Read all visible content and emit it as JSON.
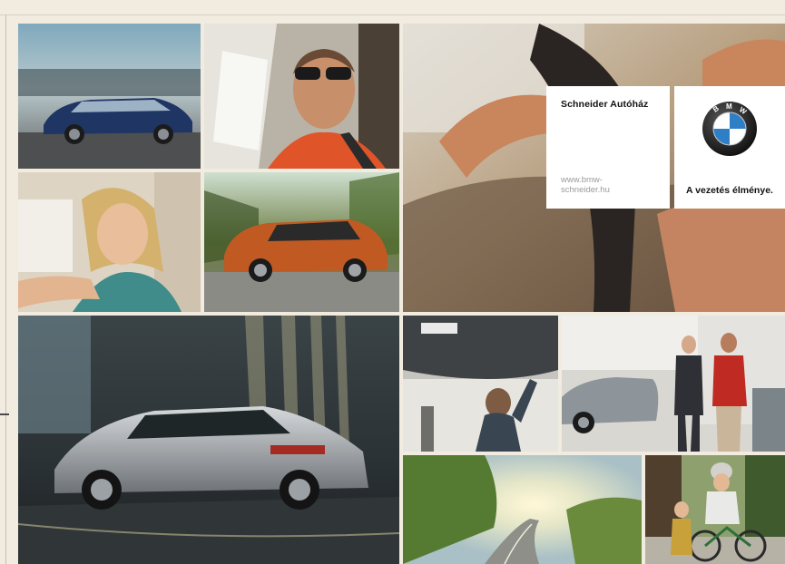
{
  "dealer": {
    "name": "Schneider Autóház",
    "url_line1": "www.bmw-",
    "url_line2": "schneider.hu"
  },
  "brand": {
    "logo_letters": [
      "B",
      "M",
      "W"
    ],
    "slogan": "A vezetés élménye."
  },
  "photos": [
    "blue-sedan-photo",
    "smiling-driver-photo",
    "hands-on-wheel-photo",
    "smiling-woman-driver-photo",
    "orange-suv-photo",
    "silver-gran-turismo-photo",
    "mechanic-under-car-photo",
    "dealership-handshake-photo",
    "sunlit-road-photo",
    "child-on-bike-photo"
  ],
  "colors": {
    "background": "#f1ebe0",
    "bmw_blue": "#2f7fc7",
    "card": "#ffffff"
  }
}
